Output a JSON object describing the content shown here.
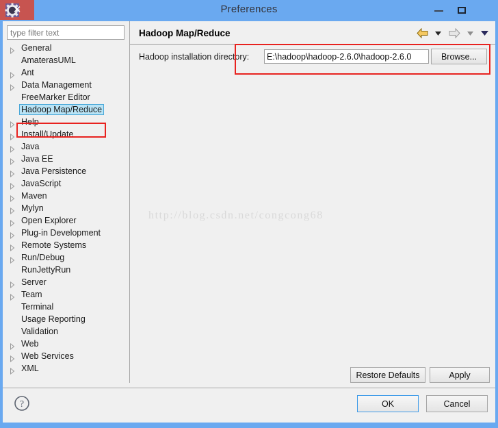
{
  "window": {
    "title": "Preferences",
    "icon": "gear-icon",
    "controls": {
      "minimize": "–",
      "maximize": "□",
      "close": "✕"
    },
    "colors": {
      "titlebar": "#6aa9f0",
      "close_button": "#c75450",
      "accent": "#3c9ae8",
      "annotation": "#e8221f",
      "selection": "#b9e3f5"
    }
  },
  "sidebar": {
    "filter": {
      "value": "",
      "placeholder": "type filter text"
    },
    "items": [
      {
        "label": "General",
        "expandable": true,
        "selected": false
      },
      {
        "label": "AmaterasUML",
        "expandable": false,
        "selected": false
      },
      {
        "label": "Ant",
        "expandable": true,
        "selected": false
      },
      {
        "label": "Data Management",
        "expandable": true,
        "selected": false
      },
      {
        "label": "FreeMarker Editor",
        "expandable": false,
        "selected": false
      },
      {
        "label": "Hadoop Map/Reduce",
        "expandable": false,
        "selected": true
      },
      {
        "label": "Help",
        "expandable": true,
        "selected": false
      },
      {
        "label": "Install/Update",
        "expandable": true,
        "selected": false
      },
      {
        "label": "Java",
        "expandable": true,
        "selected": false
      },
      {
        "label": "Java EE",
        "expandable": true,
        "selected": false
      },
      {
        "label": "Java Persistence",
        "expandable": true,
        "selected": false
      },
      {
        "label": "JavaScript",
        "expandable": true,
        "selected": false
      },
      {
        "label": "Maven",
        "expandable": true,
        "selected": false
      },
      {
        "label": "Mylyn",
        "expandable": true,
        "selected": false
      },
      {
        "label": "Open Explorer",
        "expandable": true,
        "selected": false
      },
      {
        "label": "Plug-in Development",
        "expandable": true,
        "selected": false
      },
      {
        "label": "Remote Systems",
        "expandable": true,
        "selected": false
      },
      {
        "label": "Run/Debug",
        "expandable": true,
        "selected": false
      },
      {
        "label": "RunJettyRun",
        "expandable": false,
        "selected": false
      },
      {
        "label": "Server",
        "expandable": true,
        "selected": false
      },
      {
        "label": "Team",
        "expandable": true,
        "selected": false
      },
      {
        "label": "Terminal",
        "expandable": false,
        "selected": false
      },
      {
        "label": "Usage Reporting",
        "expandable": false,
        "selected": false
      },
      {
        "label": "Validation",
        "expandable": false,
        "selected": false
      },
      {
        "label": "Web",
        "expandable": true,
        "selected": false
      },
      {
        "label": "Web Services",
        "expandable": true,
        "selected": false
      },
      {
        "label": "XML",
        "expandable": true,
        "selected": false
      }
    ]
  },
  "page": {
    "title": "Hadoop Map/Reduce",
    "nav": {
      "back_icon": "back-arrow-icon",
      "back_menu_icon": "chevron-down-icon",
      "forward_icon": "forward-arrow-icon",
      "forward_menu_icon": "chevron-down-icon",
      "menu_icon": "chevron-down-icon"
    },
    "field": {
      "label": "Hadoop installation directory:",
      "value": "E:\\hadoop\\hadoop-2.6.0\\hadoop-2.6.0",
      "placeholder": "",
      "browse_label": "Browse..."
    },
    "watermark": "http://blog.csdn.net/congcong68",
    "restore_defaults_label": "Restore Defaults",
    "apply_label": "Apply"
  },
  "footer": {
    "help_icon": "help-question-icon",
    "ok_label": "OK",
    "cancel_label": "Cancel"
  }
}
